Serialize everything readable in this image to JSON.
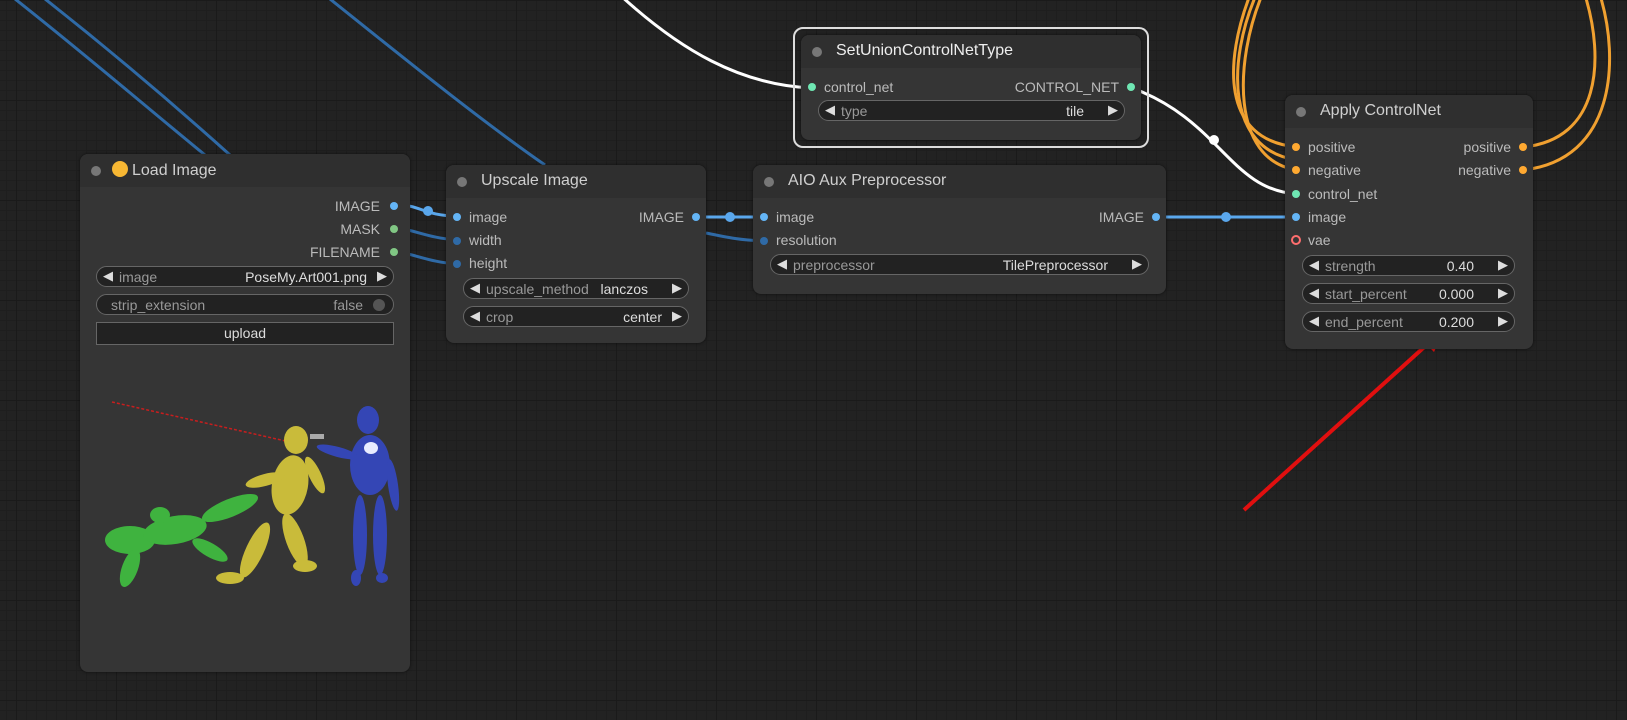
{
  "colors": {
    "image": "#64b5f6",
    "mask": "#81c784",
    "control_net": "#6fe7b3",
    "conditioning": "#ffa931",
    "vae": "#ff6e6e",
    "int": "#4a8ac4",
    "arrow": "#e10f0f"
  },
  "load_image": {
    "title": "Load Image",
    "title_icon": "cat-face-icon",
    "outputs": [
      "IMAGE",
      "MASK",
      "FILENAME"
    ],
    "image_label": "image",
    "image_value": "PoseMy.Art001.png",
    "strip_label": "strip_extension",
    "strip_value": "false",
    "upload_label": "upload"
  },
  "upscale": {
    "title": "Upscale Image",
    "inputs": [
      "image",
      "width",
      "height"
    ],
    "output": "IMAGE",
    "method_label": "upscale_method",
    "method_value": "lanczos",
    "crop_label": "crop",
    "crop_value": "center"
  },
  "aio": {
    "title": "AIO Aux Preprocessor",
    "inputs": [
      "image",
      "resolution"
    ],
    "output": "IMAGE",
    "pre_label": "preprocessor",
    "pre_value": "TilePreprocessor"
  },
  "union": {
    "title": "SetUnionControlNetType",
    "input": "control_net",
    "output": "CONTROL_NET",
    "type_label": "type",
    "type_value": "tile"
  },
  "apply": {
    "title": "Apply ControlNet",
    "inputs": [
      "positive",
      "negative",
      "control_net",
      "image",
      "vae"
    ],
    "outputs": [
      "positive",
      "negative"
    ],
    "strength_label": "strength",
    "strength_value": "0.40",
    "start_label": "start_percent",
    "start_value": "0.000",
    "end_label": "end_percent",
    "end_value": "0.200"
  }
}
